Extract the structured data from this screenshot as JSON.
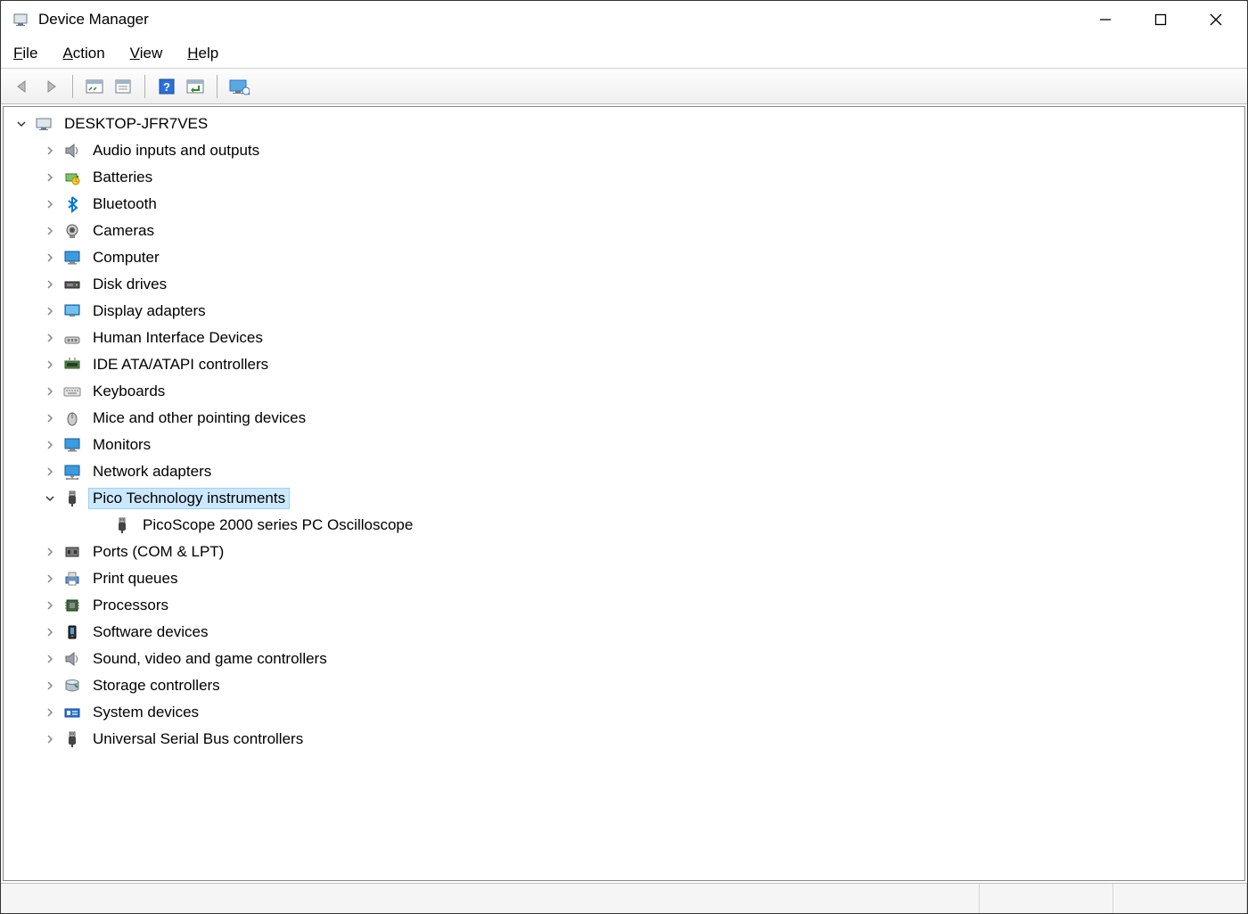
{
  "window": {
    "title": "Device Manager"
  },
  "menu": {
    "file": "File",
    "action": "Action",
    "view": "View",
    "help": "Help"
  },
  "tree": {
    "root": {
      "label": "DESKTOP-JFR7VES",
      "expanded": true
    },
    "categories": [
      {
        "label": "Audio inputs and outputs",
        "icon": "speaker",
        "expanded": false
      },
      {
        "label": "Batteries",
        "icon": "battery",
        "expanded": false
      },
      {
        "label": "Bluetooth",
        "icon": "bluetooth",
        "expanded": false
      },
      {
        "label": "Cameras",
        "icon": "camera",
        "expanded": false
      },
      {
        "label": "Computer",
        "icon": "monitor",
        "expanded": false
      },
      {
        "label": "Disk drives",
        "icon": "disk",
        "expanded": false
      },
      {
        "label": "Display adapters",
        "icon": "display",
        "expanded": false
      },
      {
        "label": "Human Interface Devices",
        "icon": "hid",
        "expanded": false
      },
      {
        "label": "IDE ATA/ATAPI controllers",
        "icon": "ide",
        "expanded": false
      },
      {
        "label": "Keyboards",
        "icon": "keyboard",
        "expanded": false
      },
      {
        "label": "Mice and other pointing devices",
        "icon": "mouse",
        "expanded": false
      },
      {
        "label": "Monitors",
        "icon": "monitor",
        "expanded": false
      },
      {
        "label": "Network adapters",
        "icon": "network",
        "expanded": false
      },
      {
        "label": "Pico Technology instruments",
        "icon": "usb-plug",
        "expanded": true,
        "selected": true,
        "children": [
          {
            "label": "PicoScope 2000 series PC Oscilloscope",
            "icon": "usb-plug"
          }
        ]
      },
      {
        "label": "Ports (COM & LPT)",
        "icon": "port",
        "expanded": false
      },
      {
        "label": "Print queues",
        "icon": "printer",
        "expanded": false
      },
      {
        "label": "Processors",
        "icon": "cpu",
        "expanded": false
      },
      {
        "label": "Software devices",
        "icon": "software",
        "expanded": false
      },
      {
        "label": "Sound, video and game controllers",
        "icon": "speaker",
        "expanded": false
      },
      {
        "label": "Storage controllers",
        "icon": "storage",
        "expanded": false
      },
      {
        "label": "System devices",
        "icon": "system",
        "expanded": false
      },
      {
        "label": "Universal Serial Bus controllers",
        "icon": "usb-plug",
        "expanded": false
      }
    ]
  }
}
